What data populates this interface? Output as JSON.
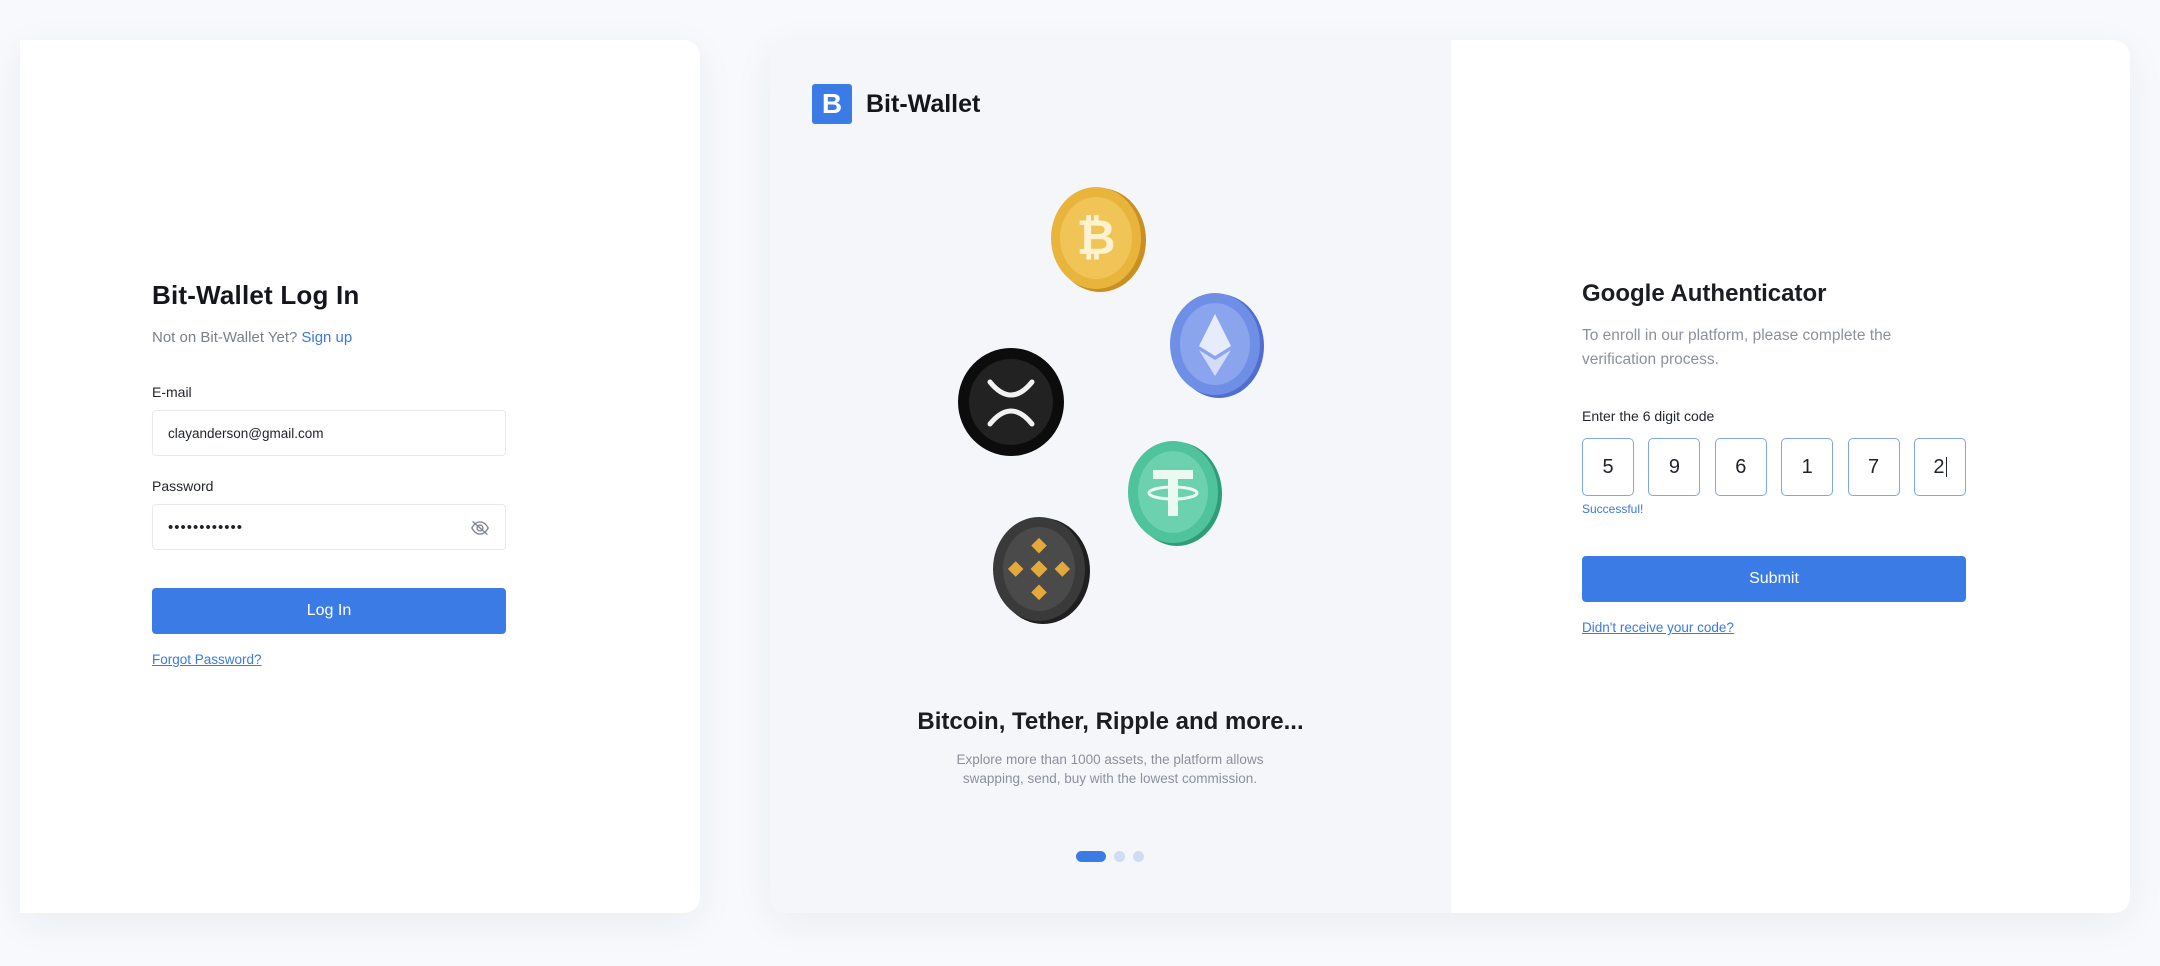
{
  "login": {
    "title": "Bit-Wallet Log In",
    "subtitle_text": "Not on Bit-Wallet Yet?",
    "signup_link": "Sign up",
    "email_label": "E-mail",
    "email_value": "clayanderson@gmail.com",
    "password_label": "Password",
    "password_masked": "••••••••••••",
    "login_button": "Log In",
    "forgot_link": "Forgot Password?",
    "icons": {
      "password_toggle": "eye-off-icon"
    }
  },
  "brand": {
    "logo_letter": "B",
    "name": "Bit-Wallet"
  },
  "promo": {
    "coins": [
      "bitcoin-coin-icon",
      "ethereum-coin-icon",
      "ripple-coin-icon",
      "tether-coin-icon",
      "binance-coin-icon"
    ],
    "title": "Bitcoin, Tether, Ripple and more...",
    "description": "Explore more than 1000 assets, the platform allows swapping, send, buy with the lowest commission.",
    "carousel": {
      "total": 3,
      "active": 1
    }
  },
  "auth": {
    "title": "Google Authenticator",
    "description": "To enroll in our platform, please complete the verification process.",
    "code_label": "Enter the 6 digit code",
    "digits": [
      "5",
      "9",
      "6",
      "1",
      "7",
      "2"
    ],
    "status": "Successful!",
    "submit_button": "Submit",
    "resend_link": "Didn't receive your code?"
  },
  "colors": {
    "accent": "#3b7be6",
    "page_bg": "#f7f9fc",
    "promo_bg": "#f4f6fa",
    "muted_text": "#8b909c",
    "bitcoin": "#e8b43c",
    "ethereum": "#6f8fe6",
    "tether": "#4fc39c",
    "ripple": "#1a1a1a",
    "binance": "#3a3a3a"
  }
}
